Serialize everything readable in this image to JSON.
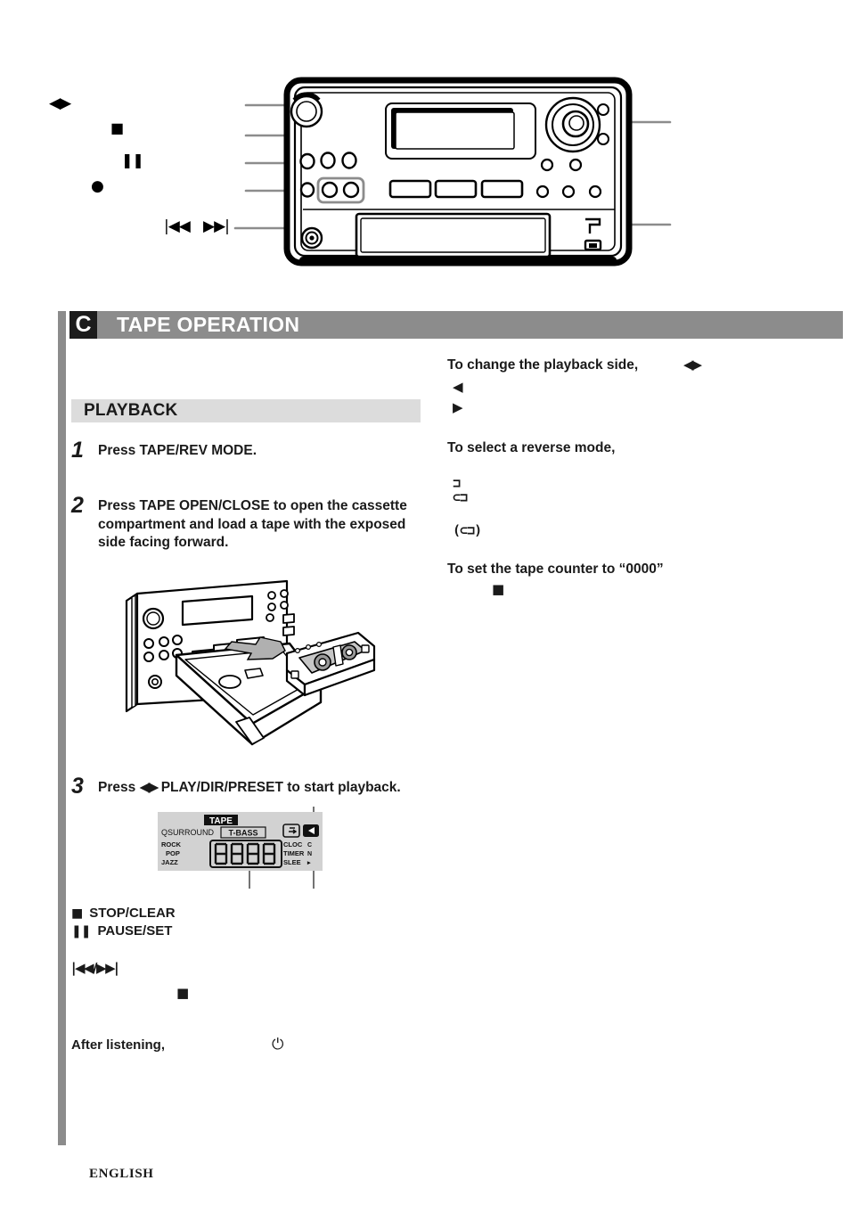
{
  "section": {
    "letter": "C",
    "title": "TAPE OPERATION"
  },
  "subsection": {
    "playback_label": "PLAYBACK"
  },
  "steps": [
    {
      "num": "1",
      "text": "Press TAPE/REV MODE."
    },
    {
      "num": "2",
      "text": "Press TAPE OPEN/CLOSE to open the cassette compartment and load a tape with the exposed side facing forward."
    },
    {
      "num": "3",
      "text_before": "Press ",
      "glyph": "◀▶",
      "text_after": " PLAY/DIR/PRESET to start playback."
    }
  ],
  "lcd": {
    "tape_badge": "TAPE",
    "qsurround": "QSURROUND",
    "t_bass": "T-BASS",
    "eq_modes": [
      "ROCK",
      "POP",
      "JAZZ"
    ],
    "counter_value": "0000",
    "right_indicators": [
      "CLOC",
      "TIMER",
      "SLEE"
    ],
    "right_indicators_edge": [
      "C",
      "N",
      "▸"
    ],
    "rev_icon": "⊂⊐",
    "dir_icon": "◀"
  },
  "notes": [
    {
      "glyph": "■",
      "label": "STOP/CLEAR"
    },
    {
      "glyph": "❚❚",
      "label": "PAUSE/SET"
    }
  ],
  "notes_extra": {
    "skip_glyph": "|◀◀/▶▶|",
    "stop_glyph": "■",
    "after_listening": "After listening,",
    "power_glyph": "⏻"
  },
  "right_column": {
    "change_side_heading": "To change the playback side,",
    "change_side_tail_glyph": "◀▶",
    "change_side_arrow_back": "◀",
    "change_side_arrow_fwd": "▶",
    "reverse_mode_heading": "To select a reverse mode,",
    "reverse_symbol_1": "⊐",
    "reverse_symbol_2": "⊂⊐",
    "reverse_symbol_3": "(⊂⊐)",
    "tape_counter_heading": "To set the tape counter to “0000”",
    "tape_counter_glyph": "■"
  },
  "top_callouts": {
    "play_dir_preset": "◀▶",
    "stop_clear": "■",
    "pause_set": "❚❚",
    "record": "●",
    "skip_back": "|◀◀",
    "skip_fwd": "▶▶|"
  },
  "footer": {
    "language": "ENGLISH"
  },
  "colors": {
    "header_bar": "#8c8c8c",
    "letter_box": "#1c1c1c",
    "subsection_bar": "#dcdcdc",
    "lcd_background": "#d2d2d2",
    "ink": "#1a1a1a"
  }
}
